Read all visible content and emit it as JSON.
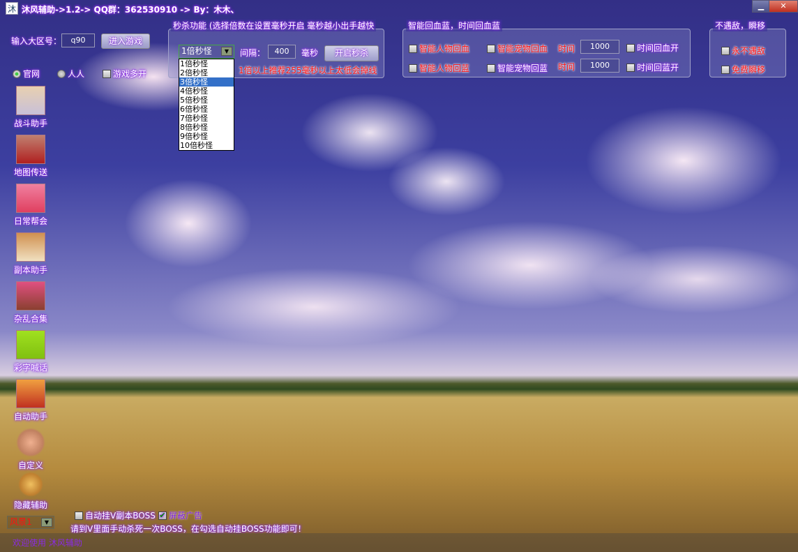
{
  "window": {
    "icon_text": "沐",
    "title": "沐风辅助->1.2-> QQ群：362530910 -> By：木木、",
    "buttons": [
      "minimize",
      "maximize",
      "close"
    ]
  },
  "login": {
    "region_label": "输入大区号：",
    "region_value": "q90",
    "enter_button": "进入游戏",
    "radios": [
      {
        "label": "官网",
        "checked": true
      },
      {
        "label": "人人",
        "checked": false
      }
    ],
    "multi_open": {
      "label": "游戏多开",
      "checked": false
    }
  },
  "seckill": {
    "title": "秒杀功能 (选择倍数在设置毫秒开启 毫秒越小出手越快",
    "selected": "1倍秒怪",
    "options": [
      "1倍秒怪",
      "2倍秒怪",
      "3倍秒怪",
      "4倍秒怪",
      "5倍秒怪",
      "6倍秒怪",
      "7倍秒怪",
      "8倍秒怪",
      "9倍秒怪",
      "10倍秒怪"
    ],
    "highlighted_index": 2,
    "interval_label": "间隔：",
    "interval_value": "400",
    "ms_label": "毫秒",
    "start_button": "开启秒杀",
    "hint": "1倍以上推荐255毫秒以上太低会掉线"
  },
  "recover": {
    "title": "智能回血蓝，时间回血蓝",
    "rows": [
      {
        "a": "智能人物回血",
        "b": "智能宠物回血",
        "time_label": "时间",
        "time_value": "1000",
        "c": "时间回血开"
      },
      {
        "a": "智能人物回蓝",
        "b": "智能宠物回蓝",
        "time_label": "时间",
        "time_value": "1000",
        "c": "时间回蓝开"
      }
    ]
  },
  "noenemy": {
    "title": "不遇敌，瞬移",
    "items": [
      "永不遇敌",
      "免费瞬移"
    ]
  },
  "sidebar": [
    "战斗助手",
    "地图传送",
    "日常帮会",
    "副本助手",
    "杂乱合集",
    "彩字喊话",
    "自动助手",
    "自定义",
    "隐藏辅助"
  ],
  "bottom": {
    "skin_value": "风景1",
    "auto_boss": {
      "label": "自动挂V副本BOSS",
      "checked": false
    },
    "block_ads": {
      "label": "屏蔽广告",
      "checked": true
    },
    "hint": "请到V里面手动杀死一次BOSS，在勾选自动挂BOSS功能即可！"
  },
  "status": {
    "text": "欢迎使用 沐风辅助"
  },
  "colors": {
    "glow": "#8a2be2",
    "red": "#ff1010",
    "selection": "#3370c8"
  }
}
